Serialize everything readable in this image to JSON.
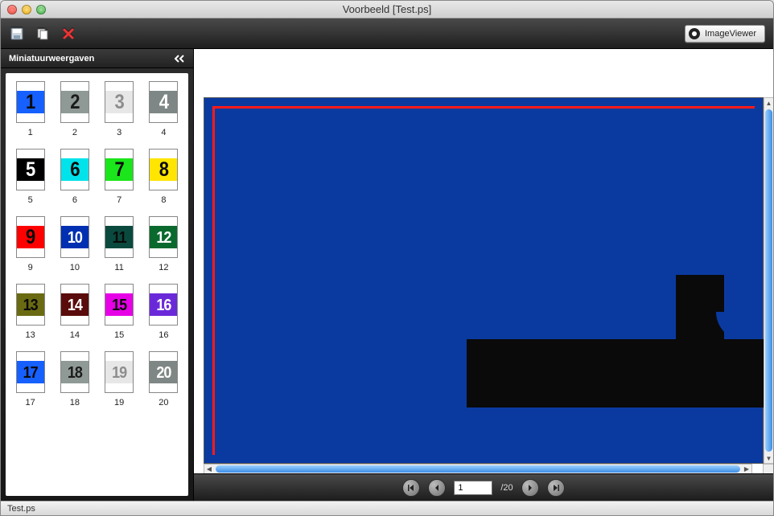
{
  "window": {
    "title": "Voorbeeld [Test.ps]"
  },
  "toolbar": {
    "save_icon": "save-icon",
    "copy_icon": "copy-icon",
    "close_icon": "close-x-icon",
    "imageviewer_label": "ImageViewer"
  },
  "sidebar": {
    "title": "Miniatuurweergaven",
    "thumbs": [
      {
        "n": 1,
        "bg": "#1660ff",
        "fg": "#0a0a0a",
        "label": "1"
      },
      {
        "n": 2,
        "bg": "#8f9a97",
        "fg": "#1b1b1b",
        "label": "2"
      },
      {
        "n": 3,
        "bg": "#e7e7e7",
        "fg": "#8d8d8d",
        "label": "3"
      },
      {
        "n": 4,
        "bg": "#7e8785",
        "fg": "#ffffff",
        "label": "4"
      },
      {
        "n": 5,
        "bg": "#000000",
        "fg": "#ffffff",
        "label": "5"
      },
      {
        "n": 6,
        "bg": "#00e3ea",
        "fg": "#0a0a0a",
        "label": "6"
      },
      {
        "n": 7,
        "bg": "#1be51b",
        "fg": "#0a0a0a",
        "label": "7"
      },
      {
        "n": 8,
        "bg": "#ffe500",
        "fg": "#0a0a0a",
        "label": "8"
      },
      {
        "n": 9,
        "bg": "#ff0000",
        "fg": "#0a0a0a",
        "label": "9"
      },
      {
        "n": 10,
        "bg": "#0030b2",
        "fg": "#ffffff",
        "label": "10"
      },
      {
        "n": 11,
        "bg": "#0a4a3e",
        "fg": "#0a0a0a",
        "label": "11"
      },
      {
        "n": 12,
        "bg": "#0a6a2e",
        "fg": "#ffffff",
        "label": "12"
      },
      {
        "n": 13,
        "bg": "#6a6a12",
        "fg": "#0a0a0a",
        "label": "13"
      },
      {
        "n": 14,
        "bg": "#5a0b0b",
        "fg": "#ffffff",
        "label": "14"
      },
      {
        "n": 15,
        "bg": "#e600e6",
        "fg": "#0a0a0a",
        "label": "15"
      },
      {
        "n": 16,
        "bg": "#6a29d9",
        "fg": "#ffffff",
        "label": "16"
      },
      {
        "n": 17,
        "bg": "#1660ff",
        "fg": "#0a0a0a",
        "label": "17"
      },
      {
        "n": 18,
        "bg": "#8f9a97",
        "fg": "#1b1b1b",
        "label": "18"
      },
      {
        "n": 19,
        "bg": "#e7e7e7",
        "fg": "#8d8d8d",
        "label": "19"
      },
      {
        "n": 20,
        "bg": "#7e8785",
        "fg": "#ffffff",
        "label": "20"
      }
    ]
  },
  "pager": {
    "current": "1",
    "total": "/20"
  },
  "status": {
    "filename": "Test.ps"
  },
  "preview": {
    "page_bg": "#0a3aa0",
    "frame_color": "#ff1a1a"
  }
}
